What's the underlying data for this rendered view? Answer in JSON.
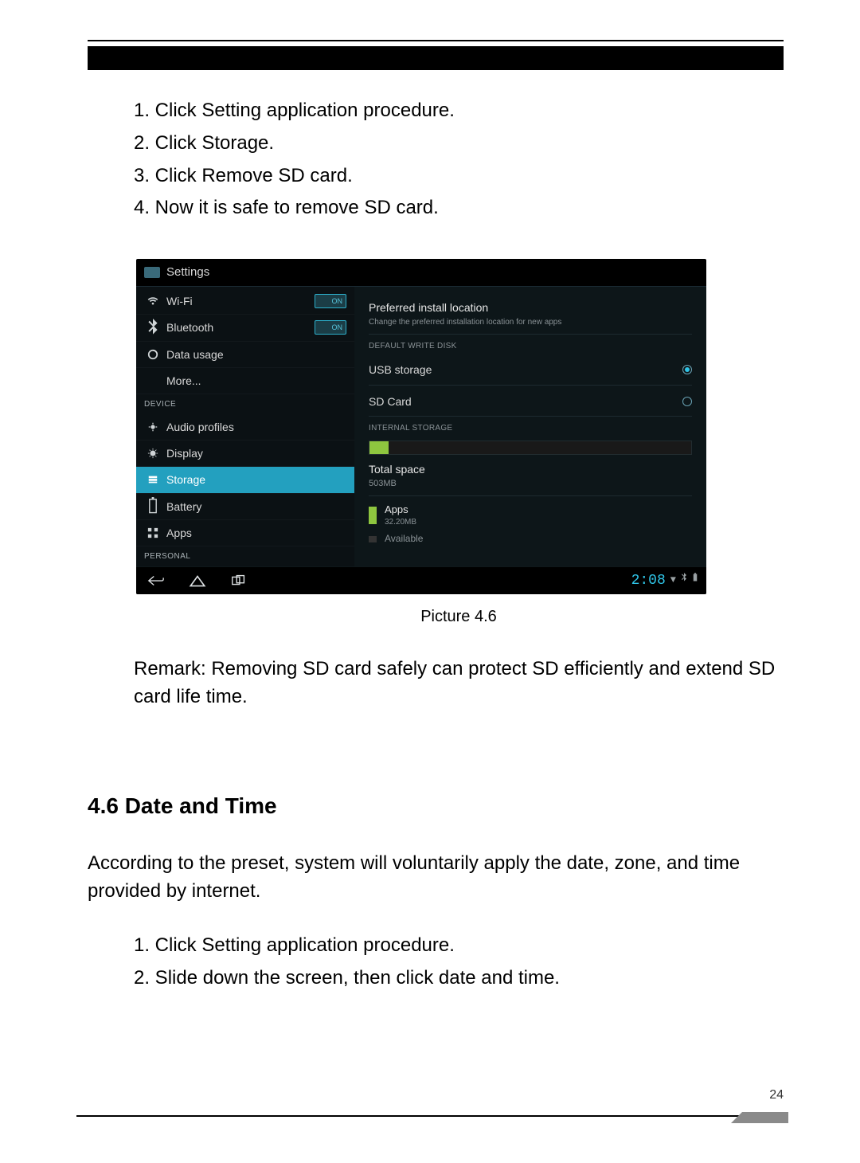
{
  "doc": {
    "steps_a": [
      "1. Click Setting application procedure.",
      "2. Click Storage.",
      "3. Click Remove SD card.",
      "4. Now it is safe to remove SD card."
    ],
    "caption": "Picture 4.6",
    "remark": "Remark: Removing SD card safely can protect SD efficiently and extend SD card life time.",
    "heading": "4.6 Date and Time",
    "para": "According to the preset, system will voluntarily apply the date, zone, and time provided by internet.",
    "steps_b": [
      "1. Click Setting application procedure.",
      "2. Slide down the screen, then click date and time."
    ],
    "page_number": "24"
  },
  "shot": {
    "header": "Settings",
    "sidebar": {
      "wifi": "Wi-Fi",
      "bluetooth": "Bluetooth",
      "data": "Data usage",
      "more": "More...",
      "section_device": "DEVICE",
      "audio": "Audio profiles",
      "display": "Display",
      "storage": "Storage",
      "battery": "Battery",
      "apps": "Apps",
      "section_personal": "PERSONAL",
      "toggle_on": "ON"
    },
    "main": {
      "pref_title": "Preferred install location",
      "pref_sub": "Change the preferred installation location for new apps",
      "section_default": "DEFAULT WRITE DISK",
      "usb": "USB storage",
      "sd": "SD Card",
      "section_internal": "INTERNAL STORAGE",
      "total_label": "Total space",
      "total_value": "503MB",
      "apps_label": "Apps",
      "apps_value": "32.20MB",
      "available": "Available"
    },
    "navbar": {
      "clock": "2:08"
    }
  }
}
